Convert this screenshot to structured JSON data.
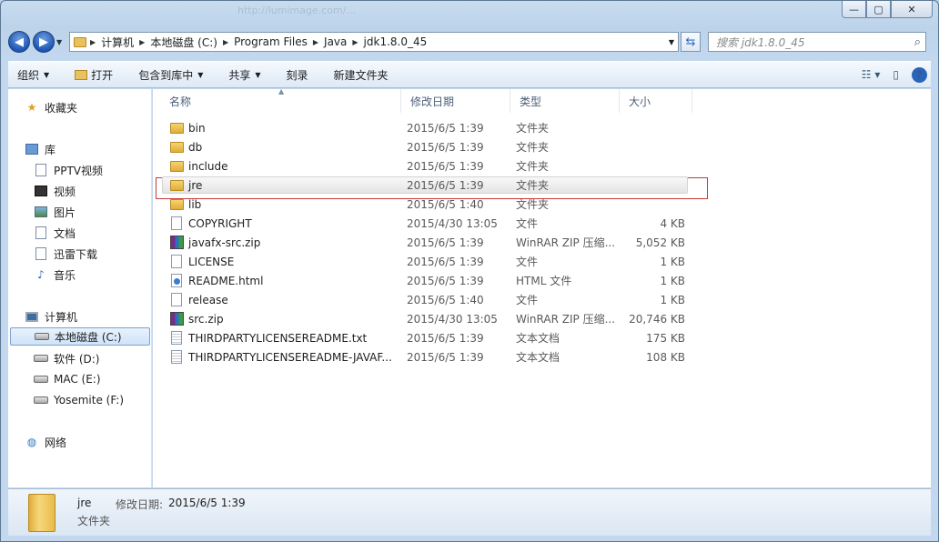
{
  "window": {
    "ghost_text": "http://lumimage.com/...",
    "min_label": "—",
    "max_label": "▢",
    "close_label": "✕"
  },
  "address": {
    "crumbs": [
      "计算机",
      "本地磁盘 (C:)",
      "Program Files",
      "Java",
      "jdk1.8.0_45"
    ],
    "search_placeholder": "搜索 jdk1.8.0_45"
  },
  "toolbar": {
    "organize": "组织",
    "open": "打开",
    "include_library": "包含到库中",
    "share": "共享",
    "burn": "刻录",
    "new_folder": "新建文件夹",
    "help": "?"
  },
  "sidebar": {
    "favorites": "收藏夹",
    "libraries": "库",
    "lib_items": [
      "PPTV视频",
      "视频",
      "图片",
      "文档",
      "迅雷下载",
      "音乐"
    ],
    "computer": "计算机",
    "drives": [
      "本地磁盘 (C:)",
      "软件 (D:)",
      "MAC (E:)",
      "Yosemite (F:)"
    ],
    "network": "网络"
  },
  "columns": {
    "name": "名称",
    "date": "修改日期",
    "type": "类型",
    "size": "大小"
  },
  "files": [
    {
      "name": "bin",
      "date": "2015/6/5 1:39",
      "type": "文件夹",
      "size": "",
      "icon": "folder"
    },
    {
      "name": "db",
      "date": "2015/6/5 1:39",
      "type": "文件夹",
      "size": "",
      "icon": "folder"
    },
    {
      "name": "include",
      "date": "2015/6/5 1:39",
      "type": "文件夹",
      "size": "",
      "icon": "folder"
    },
    {
      "name": "jre",
      "date": "2015/6/5 1:39",
      "type": "文件夹",
      "size": "",
      "icon": "folder"
    },
    {
      "name": "lib",
      "date": "2015/6/5 1:40",
      "type": "文件夹",
      "size": "",
      "icon": "folder"
    },
    {
      "name": "COPYRIGHT",
      "date": "2015/4/30 13:05",
      "type": "文件",
      "size": "4 KB",
      "icon": "file"
    },
    {
      "name": "javafx-src.zip",
      "date": "2015/6/5 1:39",
      "type": "WinRAR ZIP 压缩...",
      "size": "5,052 KB",
      "icon": "zip"
    },
    {
      "name": "LICENSE",
      "date": "2015/6/5 1:39",
      "type": "文件",
      "size": "1 KB",
      "icon": "file"
    },
    {
      "name": "README.html",
      "date": "2015/6/5 1:39",
      "type": "HTML 文件",
      "size": "1 KB",
      "icon": "html"
    },
    {
      "name": "release",
      "date": "2015/6/5 1:40",
      "type": "文件",
      "size": "1 KB",
      "icon": "file"
    },
    {
      "name": "src.zip",
      "date": "2015/4/30 13:05",
      "type": "WinRAR ZIP 压缩...",
      "size": "20,746 KB",
      "icon": "zip"
    },
    {
      "name": "THIRDPARTYLICENSEREADME.txt",
      "date": "2015/6/5 1:39",
      "type": "文本文档",
      "size": "175 KB",
      "icon": "txt"
    },
    {
      "name": "THIRDPARTYLICENSEREADME-JAVAF...",
      "date": "2015/6/5 1:39",
      "type": "文本文档",
      "size": "108 KB",
      "icon": "txt"
    }
  ],
  "selected_index": 3,
  "details": {
    "name": "jre",
    "modified_label": "修改日期:",
    "modified_value": "2015/6/5 1:39",
    "type": "文件夹"
  }
}
